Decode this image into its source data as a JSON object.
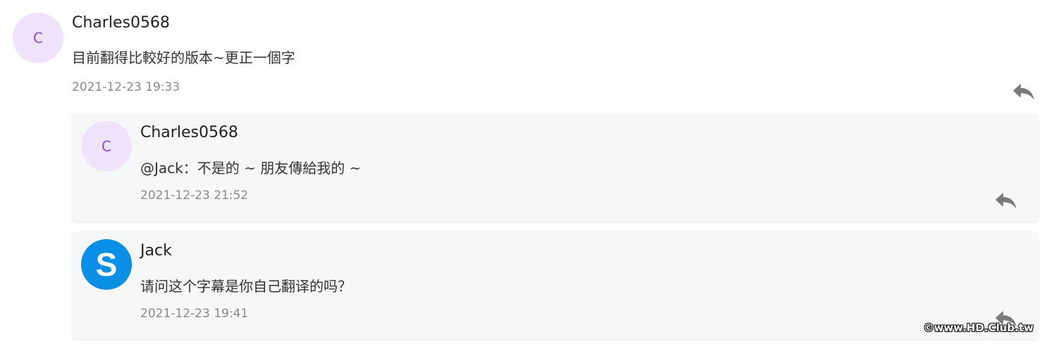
{
  "main_comment": {
    "avatar_letter": "C",
    "username": "Charles0568",
    "content": "目前翻得比較好的版本~更正一個字",
    "timestamp": "2021-12-23 19:33"
  },
  "replies": [
    {
      "avatar_letter": "C",
      "username": "Charles0568",
      "content": "@Jack：不是的 ~ 朋友傳給我的 ~",
      "timestamp": "2021-12-23 21:52"
    },
    {
      "avatar_letter": "S",
      "username": "Jack",
      "content": "请问这个字幕是你自己翻译的吗？",
      "timestamp": "2021-12-23 19:41"
    }
  ],
  "watermark": "©www.HD.Club.tw",
  "icons": {
    "reply": "reply-icon"
  },
  "colors": {
    "avatar_bg": "#efe3fb",
    "avatar_letter": "#7e4fd0",
    "card_bg": "#f6f7f9",
    "skype_blue": "#0a8fe6",
    "timestamp": "#8a8a8a"
  }
}
